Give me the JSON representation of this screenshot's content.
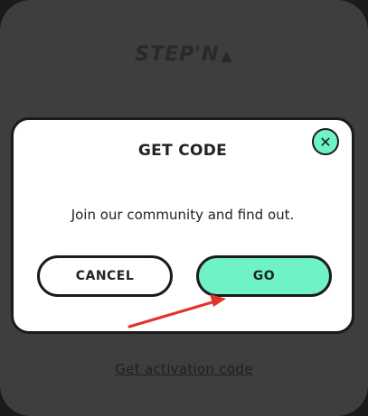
{
  "app": {
    "logo_text": "STEP'N",
    "logo_mark": "▲",
    "activation_link": "Get activation code"
  },
  "modal": {
    "title": "GET CODE",
    "close_glyph": "✕",
    "message": "Join our community and find out.",
    "cancel_label": "CANCEL",
    "go_label": "GO"
  },
  "colors": {
    "accent": "#6ff3c4",
    "panel": "#3f3d3d",
    "annotation_arrow": "#e0332a"
  },
  "annotation": {
    "type": "arrow",
    "target": "go-button"
  }
}
